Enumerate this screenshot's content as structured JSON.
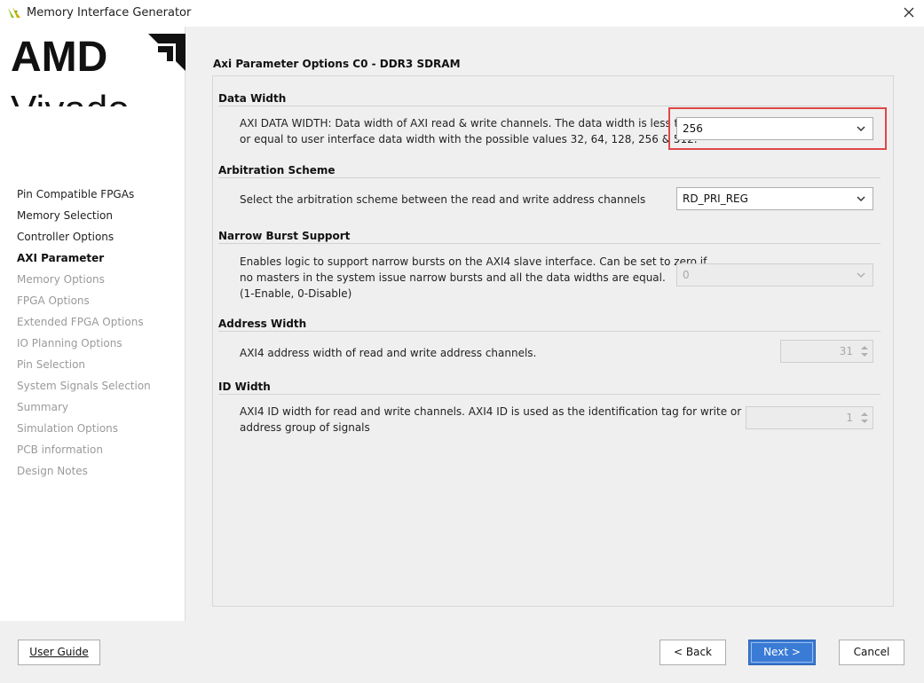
{
  "window": {
    "title": "Memory Interface Generator"
  },
  "logo": {
    "brand": "AMD",
    "product": "Vivado"
  },
  "nav": {
    "items": [
      {
        "label": "Pin Compatible FPGAs",
        "state": "done"
      },
      {
        "label": "Memory Selection",
        "state": "done"
      },
      {
        "label": "Controller Options",
        "state": "done"
      },
      {
        "label": "AXI Parameter",
        "state": "current"
      },
      {
        "label": "Memory Options",
        "state": "pending"
      },
      {
        "label": "FPGA Options",
        "state": "pending"
      },
      {
        "label": "Extended FPGA Options",
        "state": "pending"
      },
      {
        "label": "IO Planning Options",
        "state": "pending"
      },
      {
        "label": "Pin Selection",
        "state": "pending"
      },
      {
        "label": "System Signals Selection",
        "state": "pending"
      },
      {
        "label": "Summary",
        "state": "pending"
      },
      {
        "label": "Simulation Options",
        "state": "pending"
      },
      {
        "label": "PCB information",
        "state": "pending"
      },
      {
        "label": "Design Notes",
        "state": "pending"
      }
    ]
  },
  "page": {
    "title": "Axi Parameter Options C0 - DDR3 SDRAM"
  },
  "groups": {
    "data_width": {
      "heading": "Data Width",
      "desc_line1": "AXI DATA WIDTH: Data width of AXI read & write channels. The data width is less than",
      "desc_line2": "or equal to user interface data width with the possible values 32, 64, 128, 256 & 512.",
      "value": "256"
    },
    "arbitration": {
      "heading": "Arbitration Scheme",
      "desc": "Select the arbitration scheme between the read and write address channels",
      "value": "RD_PRI_REG"
    },
    "narrow_burst": {
      "heading": "Narrow Burst Support",
      "desc_line1": "Enables logic to support narrow bursts on the AXI4 slave interface. Can be set to zero if",
      "desc_line2": "no masters in the system issue narrow bursts and all the data widths are equal.",
      "desc_line3": "(1-Enable, 0-Disable)",
      "value": "0"
    },
    "address_width": {
      "heading": "Address Width",
      "desc": "AXI4 address width of read and write address channels.",
      "value": "31"
    },
    "id_width": {
      "heading": "ID Width",
      "desc_line1": "AXI4 ID width for read and write channels. AXI4 ID is used as the identification tag for write or read",
      "desc_line2": "address group of signals",
      "value": "1"
    }
  },
  "buttons": {
    "user_guide": "User Guide",
    "back": "< Back",
    "next": "Next >",
    "cancel": "Cancel"
  },
  "colors": {
    "highlight": "#e04646",
    "primary": "#3a7bd5",
    "logo_green": "#8fc31f"
  }
}
